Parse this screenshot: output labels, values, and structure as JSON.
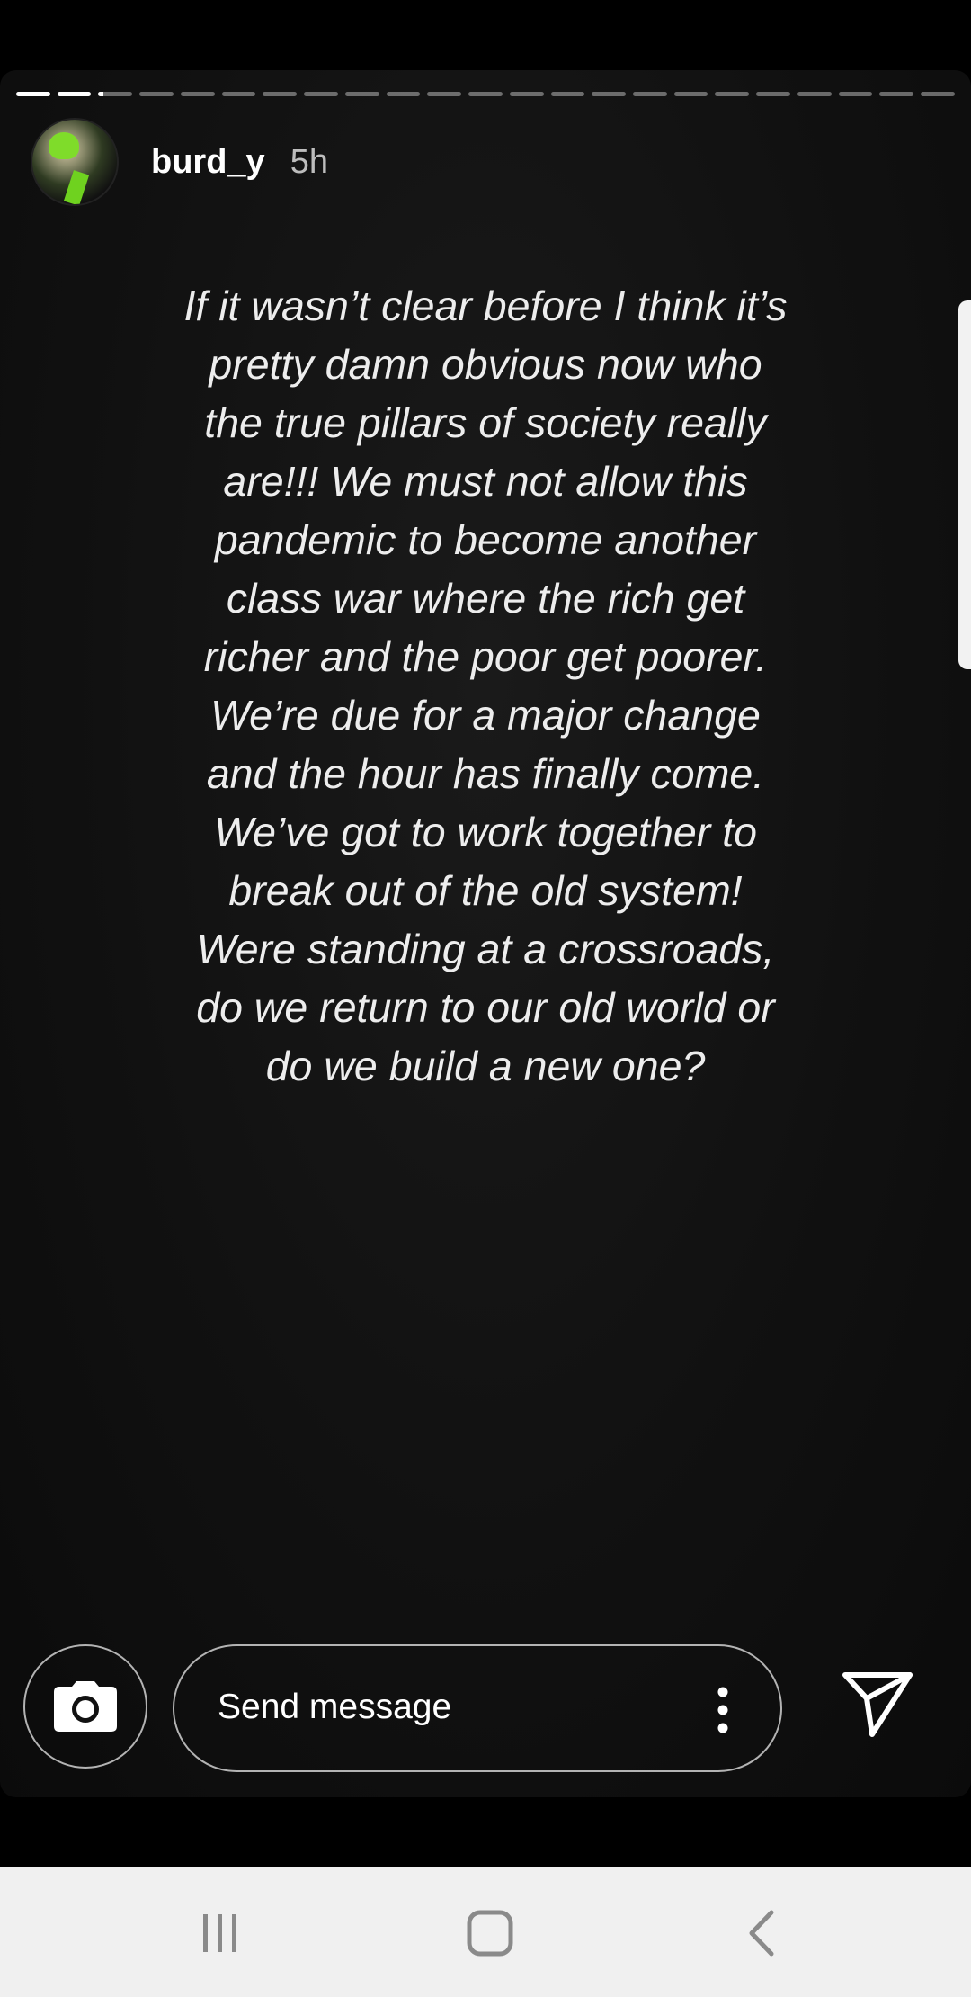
{
  "story": {
    "progress": {
      "segments": 23,
      "completed": 2,
      "current_fraction": 0.15
    },
    "user": {
      "username": "burd_y",
      "timestamp": "5h",
      "avatar_icon": "profile-photo"
    },
    "text": "If it wasn’t clear before I think it’s pretty damn obvious now who the true pillars of society really are!!! We must not allow this pandemic to become another class war where the rich get richer and the poor get poorer. We’re due for a major change and the hour has finally come. We’ve got to work together to break out of the old system! Were standing at a crossroads, do we return to our old world or do we build a new one?"
  },
  "reply_bar": {
    "camera_icon": "camera-icon",
    "placeholder": "Send message",
    "more_icon": "more-vertical-icon",
    "send_icon": "send-icon"
  },
  "nav_bar": {
    "items": [
      {
        "icon": "recent-apps-icon"
      },
      {
        "icon": "home-icon"
      },
      {
        "icon": "back-icon"
      }
    ]
  },
  "colors": {
    "background": "#000000",
    "story_background": "#111111",
    "text": "#ededed",
    "nav_background": "#f0f0f0",
    "avatar_accent": "#7fdc2a"
  }
}
